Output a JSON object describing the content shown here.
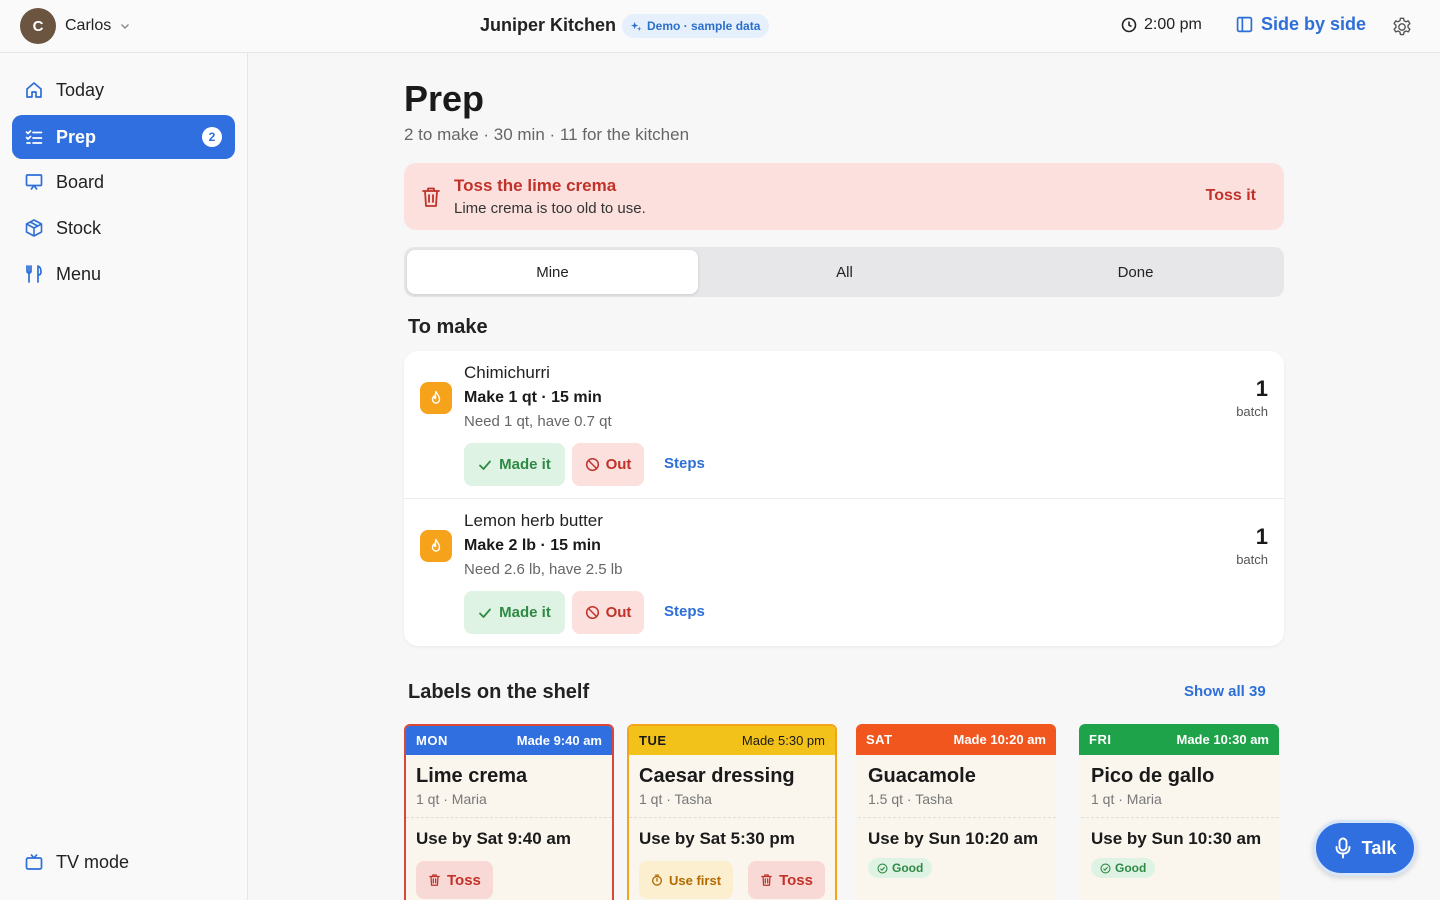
{
  "header": {
    "user_initial": "C",
    "user_name": "Carlos",
    "kitchen_name": "Juniper Kitchen",
    "demo_badge": "Demo · sample data",
    "time": "2:00 pm",
    "side_by_side": "Side by side",
    "accent_color": "#2f6fdf"
  },
  "sidebar": {
    "items": [
      {
        "label": "Today",
        "icon": "home-icon"
      },
      {
        "label": "Prep",
        "icon": "checklist-icon",
        "badge": "2",
        "active": true
      },
      {
        "label": "Board",
        "icon": "board-icon"
      },
      {
        "label": "Stock",
        "icon": "box-icon"
      },
      {
        "label": "Menu",
        "icon": "utensils-icon"
      }
    ],
    "tv_mode": "TV mode"
  },
  "page": {
    "title": "Prep",
    "subtitle": "2 to make · 30 min · 11 for the kitchen"
  },
  "alert": {
    "title": "Toss the lime crema",
    "text": "Lime crema is too old to use.",
    "action": "Toss it"
  },
  "tabs": [
    {
      "label": "Mine",
      "active": true
    },
    {
      "label": "All"
    },
    {
      "label": "Done"
    }
  ],
  "to_make": {
    "heading": "To make",
    "items": [
      {
        "name": "Chimichurri",
        "make": "Make 1 qt · 15 min",
        "need": "Need 1 qt, have 0.7 qt",
        "batches": "1",
        "batch_unit": "batch",
        "made_label": "Made it",
        "out_label": "Out",
        "steps_label": "Steps"
      },
      {
        "name": "Lemon herb butter",
        "make": "Make 2 lb · 15 min",
        "need": "Need 2.6 lb, have 2.5 lb",
        "batches": "1",
        "batch_unit": "batch",
        "made_label": "Made it",
        "out_label": "Out",
        "steps_label": "Steps"
      }
    ]
  },
  "labels": {
    "heading": "Labels on the shelf",
    "show_all": "Show all 39",
    "cards": [
      {
        "day": "MON",
        "made": "Made 9:40 am",
        "name": "Lime crema",
        "meta": "1 qt · Maria",
        "use_by": "Use by Sat 9:40 am",
        "color": "#2f6fdf",
        "outline": "#d9473b",
        "toss": "Toss"
      },
      {
        "day": "TUE",
        "made": "Made 5:30 pm",
        "name": "Caesar dressing",
        "meta": "1 qt · Tasha",
        "use_by": "Use by Sat 5:30 pm",
        "color": "#f2c21b",
        "outline": "#f2a51b",
        "use_first": "Use first",
        "toss": "Toss"
      },
      {
        "day": "SAT",
        "made": "Made 10:20 am",
        "name": "Guacamole",
        "meta": "1.5 qt · Tasha",
        "use_by": "Use by Sun 10:20 am",
        "color": "#f0561e",
        "good": "Good"
      },
      {
        "day": "FRI",
        "made": "Made 10:30 am",
        "name": "Pico de gallo",
        "meta": "1 qt · Maria",
        "use_by": "Use by Sun 10:30 am",
        "color": "#1fa34a",
        "good": "Good"
      }
    ]
  },
  "talk_button": "Talk"
}
